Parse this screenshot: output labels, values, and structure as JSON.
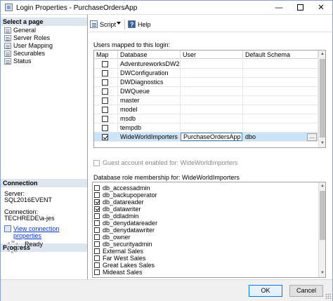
{
  "window": {
    "title": "Login Properties - PurchaseOrdersApp",
    "minimize": "—",
    "close": "✕"
  },
  "left_panel": {
    "select_page_header": "Select a page",
    "pages": [
      "General",
      "Server Roles",
      "User Mapping",
      "Securables",
      "Status"
    ],
    "connection_header": "Connection",
    "server_label": "Server:",
    "server_value": "SQL2016EVENT",
    "connection_label": "Connection:",
    "connection_value": "TECHREDE\\a-jes",
    "view_connection_link": "View connection properties",
    "progress_header": "Progress",
    "progress_status": "Ready"
  },
  "toolbar": {
    "script_label": "Script",
    "help_label": "Help"
  },
  "users_mapped": {
    "label": "Users mapped to this login:",
    "columns": [
      "Map",
      "Database",
      "User",
      "Default Schema"
    ],
    "rows": [
      {
        "map": false,
        "database": "AdventureworksDW2...",
        "user": "",
        "schema": ""
      },
      {
        "map": false,
        "database": "DWConfiguration",
        "user": "",
        "schema": ""
      },
      {
        "map": false,
        "database": "DWDiagnostics",
        "user": "",
        "schema": ""
      },
      {
        "map": false,
        "database": "DWQueue",
        "user": "",
        "schema": ""
      },
      {
        "map": false,
        "database": "master",
        "user": "",
        "schema": ""
      },
      {
        "map": false,
        "database": "model",
        "user": "",
        "schema": ""
      },
      {
        "map": false,
        "database": "msdb",
        "user": "",
        "schema": ""
      },
      {
        "map": false,
        "database": "tempdb",
        "user": "",
        "schema": ""
      },
      {
        "map": true,
        "database": "WideWorldImporters",
        "user": "PurchaseOrdersApp",
        "schema": "dbo",
        "selected": true
      }
    ],
    "ellipsis": "..."
  },
  "guest": {
    "label": "Guest account enabled for: WideWorldImporters",
    "enabled": false
  },
  "role_membership": {
    "label": "Database role membership for: WideWorldImporters",
    "roles": [
      {
        "name": "db_accessadmin",
        "checked": false
      },
      {
        "name": "db_backupoperator",
        "checked": false
      },
      {
        "name": "db_datareader",
        "checked": true
      },
      {
        "name": "db_datawriter",
        "checked": true
      },
      {
        "name": "db_ddladmin",
        "checked": false
      },
      {
        "name": "db_denydatareader",
        "checked": false
      },
      {
        "name": "db_denydatawriter",
        "checked": false
      },
      {
        "name": "db_owner",
        "checked": false
      },
      {
        "name": "db_securityadmin",
        "checked": false
      },
      {
        "name": "External Sales",
        "checked": false
      },
      {
        "name": "Far West Sales",
        "checked": false
      },
      {
        "name": "Great Lakes Sales",
        "checked": false
      },
      {
        "name": "Mideast Sales",
        "checked": false
      }
    ]
  },
  "buttons": {
    "ok": "OK",
    "cancel": "Cancel"
  }
}
